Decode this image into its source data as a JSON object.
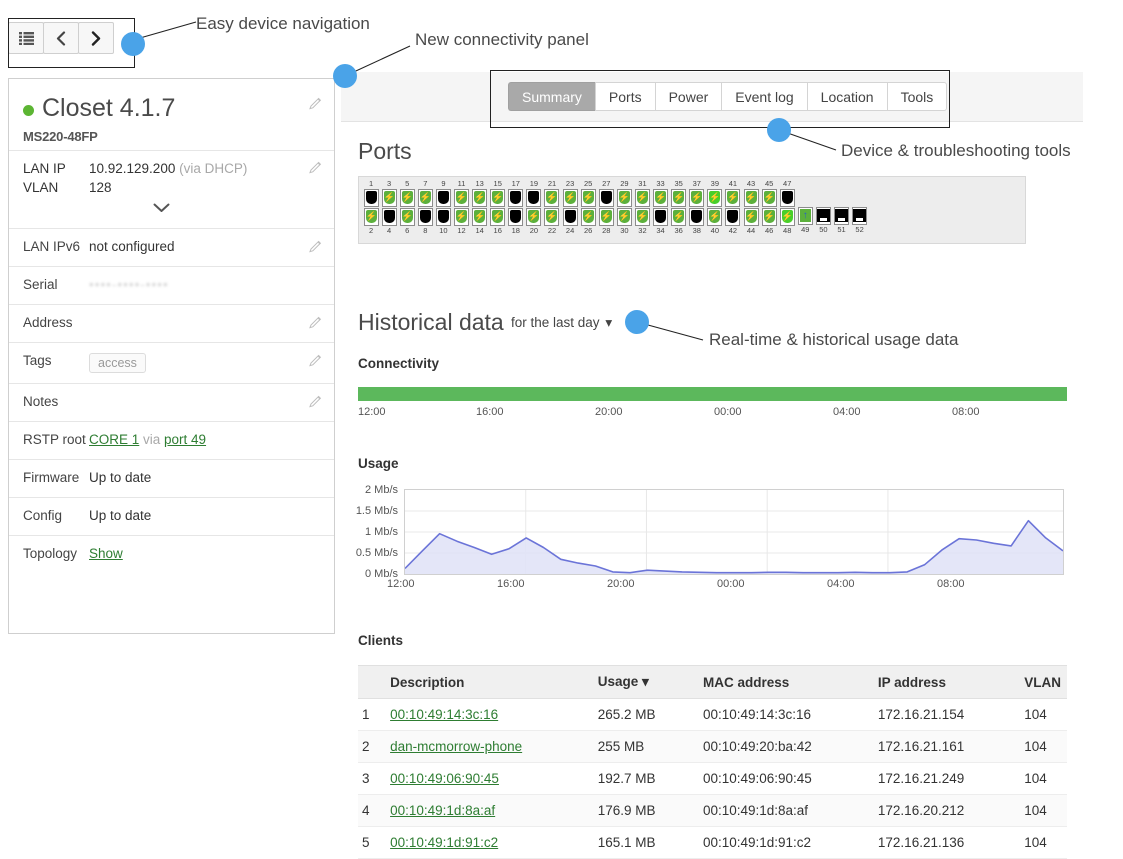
{
  "annotations": [
    {
      "id": "nav",
      "text": "Easy device navigation"
    },
    {
      "id": "conn",
      "text": "New connectivity panel"
    },
    {
      "id": "tools",
      "text": "Device & troubleshooting tools"
    },
    {
      "id": "usage",
      "text": "Real-time & historical usage data"
    }
  ],
  "nav": {
    "list_label": "list-icon",
    "prev_label": "‹",
    "next_label": "›"
  },
  "device": {
    "status_color": "#5cb533",
    "name": "Closet 4.1.7",
    "model": "MS220-48FP",
    "lan_ip_label": "LAN IP",
    "lan_ip_value": "10.92.129.200",
    "lan_ip_source": "(via DHCP)",
    "vlan_label": "VLAN",
    "vlan_value": "128",
    "rows": [
      {
        "key": "LAN IPv6",
        "value": "not configured",
        "edit": true,
        "type": "text"
      },
      {
        "key": "Serial",
        "value": "••••-••••-••••",
        "edit": false,
        "type": "blur"
      },
      {
        "key": "Address",
        "value": "",
        "edit": true,
        "type": "text"
      },
      {
        "key": "Tags",
        "value": "access",
        "edit": true,
        "type": "tag"
      },
      {
        "key": "Notes",
        "value": "",
        "edit": true,
        "type": "text"
      },
      {
        "key": "RSTP root",
        "value": "CORE 1 via port 49",
        "edit": false,
        "type": "rstp",
        "link1": "CORE 1",
        "mid": " via ",
        "link2": "port 49"
      },
      {
        "key": "Firmware",
        "value": "Up to date",
        "edit": false,
        "type": "text"
      },
      {
        "key": "Config",
        "value": "Up to date",
        "edit": false,
        "type": "text"
      },
      {
        "key": "Topology",
        "value": "Show",
        "edit": false,
        "type": "link"
      }
    ]
  },
  "tabs": [
    {
      "label": "Summary",
      "active": true
    },
    {
      "label": "Ports",
      "active": false
    },
    {
      "label": "Power",
      "active": false
    },
    {
      "label": "Event log",
      "active": false
    },
    {
      "label": "Location",
      "active": false
    },
    {
      "label": "Tools",
      "active": false
    }
  ],
  "ports": {
    "title": "Ports",
    "columns": [
      {
        "top": {
          "num": "1",
          "state": "off"
        },
        "bottom": {
          "num": "2",
          "state": "on"
        }
      },
      {
        "top": {
          "num": "3",
          "state": "on"
        },
        "bottom": {
          "num": "4",
          "state": "off"
        }
      },
      {
        "top": {
          "num": "5",
          "state": "on"
        },
        "bottom": {
          "num": "6",
          "state": "on"
        }
      },
      {
        "top": {
          "num": "7",
          "state": "on"
        },
        "bottom": {
          "num": "8",
          "state": "off"
        }
      },
      {
        "top": {
          "num": "9",
          "state": "off"
        },
        "bottom": {
          "num": "10",
          "state": "off"
        }
      },
      {
        "top": {
          "num": "11",
          "state": "on"
        },
        "bottom": {
          "num": "12",
          "state": "on"
        }
      },
      {
        "top": {
          "num": "13",
          "state": "on"
        },
        "bottom": {
          "num": "14",
          "state": "on"
        }
      },
      {
        "top": {
          "num": "15",
          "state": "on"
        },
        "bottom": {
          "num": "16",
          "state": "on"
        }
      },
      {
        "top": {
          "num": "17",
          "state": "off"
        },
        "bottom": {
          "num": "18",
          "state": "off"
        }
      },
      {
        "top": {
          "num": "19",
          "state": "off"
        },
        "bottom": {
          "num": "20",
          "state": "on"
        }
      },
      {
        "top": {
          "num": "21",
          "state": "on"
        },
        "bottom": {
          "num": "22",
          "state": "on"
        }
      },
      {
        "top": {
          "num": "23",
          "state": "on"
        },
        "bottom": {
          "num": "24",
          "state": "off"
        }
      },
      {
        "top": {
          "num": "25",
          "state": "on"
        },
        "bottom": {
          "num": "26",
          "state": "on"
        }
      },
      {
        "top": {
          "num": "27",
          "state": "off"
        },
        "bottom": {
          "num": "28",
          "state": "on"
        }
      },
      {
        "top": {
          "num": "29",
          "state": "on"
        },
        "bottom": {
          "num": "30",
          "state": "on"
        }
      },
      {
        "top": {
          "num": "31",
          "state": "on"
        },
        "bottom": {
          "num": "32",
          "state": "on"
        }
      },
      {
        "top": {
          "num": "33",
          "state": "on"
        },
        "bottom": {
          "num": "34",
          "state": "off"
        }
      },
      {
        "top": {
          "num": "35",
          "state": "on"
        },
        "bottom": {
          "num": "36",
          "state": "on"
        }
      },
      {
        "top": {
          "num": "37",
          "state": "on"
        },
        "bottom": {
          "num": "38",
          "state": "off"
        }
      },
      {
        "top": {
          "num": "39",
          "state": "on-bright"
        },
        "bottom": {
          "num": "40",
          "state": "on"
        }
      },
      {
        "top": {
          "num": "41",
          "state": "on"
        },
        "bottom": {
          "num": "42",
          "state": "off"
        }
      },
      {
        "top": {
          "num": "43",
          "state": "on"
        },
        "bottom": {
          "num": "44",
          "state": "on"
        }
      },
      {
        "top": {
          "num": "45",
          "state": "on"
        },
        "bottom": {
          "num": "46",
          "state": "on"
        }
      },
      {
        "top": {
          "num": "47",
          "state": "off"
        },
        "bottom": {
          "num": "48",
          "state": "on-bright"
        }
      },
      {
        "top": {
          "num": "",
          "state": "blank"
        },
        "bottom": {
          "num": "49",
          "state": "uplink"
        }
      },
      {
        "top": {
          "num": "",
          "state": "blank"
        },
        "bottom": {
          "num": "50",
          "state": "sfp"
        }
      },
      {
        "top": {
          "num": "",
          "state": "blank"
        },
        "bottom": {
          "num": "51",
          "state": "sfp"
        }
      },
      {
        "top": {
          "num": "",
          "state": "blank"
        },
        "bottom": {
          "num": "52",
          "state": "sfp"
        }
      }
    ]
  },
  "historical": {
    "title": "Historical data",
    "range_label": "for the last day",
    "connectivity_label": "Connectivity",
    "usage_label": "Usage"
  },
  "chart_data": [
    {
      "type": "bar",
      "title": "Connectivity",
      "categories": [
        "12:00",
        "16:00",
        "20:00",
        "00:00",
        "04:00",
        "08:00"
      ],
      "values": [
        100,
        100,
        100,
        100,
        100,
        100
      ],
      "color": "#5cb85c",
      "ylabel": "",
      "xlabel": "",
      "grid": false,
      "legend": "none"
    },
    {
      "type": "area",
      "title": "Usage",
      "xlabel": "",
      "ylabel": "Mb/s",
      "ylim": [
        0,
        2
      ],
      "yticks": [
        "0 Mb/s",
        "0.5 Mb/s",
        "1 Mb/s",
        "1.5 Mb/s",
        "2 Mb/s"
      ],
      "xticks": [
        "12:00",
        "16:00",
        "20:00",
        "00:00",
        "04:00",
        "08:00"
      ],
      "grid": true,
      "legend": "none",
      "line_color": "#6b74d8",
      "fill_color": "#dfe2f7",
      "x": [
        0,
        1,
        2,
        3,
        4,
        5,
        6,
        7,
        8,
        9,
        10,
        11,
        12,
        13,
        14,
        15,
        16,
        17,
        18,
        19,
        20,
        21,
        22,
        23,
        24,
        25,
        26,
        27,
        28,
        29,
        30,
        31,
        32,
        33,
        34,
        35,
        36,
        37,
        38
      ],
      "values": [
        0.13,
        0.55,
        0.96,
        0.78,
        0.63,
        0.47,
        0.6,
        0.86,
        0.63,
        0.35,
        0.26,
        0.19,
        0.05,
        0.03,
        0.09,
        0.07,
        0.05,
        0.04,
        0.03,
        0.03,
        0.03,
        0.04,
        0.04,
        0.03,
        0.03,
        0.03,
        0.04,
        0.03,
        0.03,
        0.05,
        0.22,
        0.57,
        0.84,
        0.81,
        0.73,
        0.67,
        1.27,
        0.86,
        0.55
      ]
    }
  ],
  "clients": {
    "title": "Clients",
    "headers": [
      "",
      "Description",
      "Usage ▾",
      "MAC address",
      "IP address",
      "VLAN"
    ],
    "rows": [
      {
        "idx": "1",
        "desc": "00:10:49:14:3c:16",
        "usage": "265.2 MB",
        "mac": "00:10:49:14:3c:16",
        "ip": "172.16.21.154",
        "vlan": "104"
      },
      {
        "idx": "2",
        "desc": "dan-mcmorrow-phone",
        "usage": "255 MB",
        "mac": "00:10:49:20:ba:42",
        "ip": "172.16.21.161",
        "vlan": "104"
      },
      {
        "idx": "3",
        "desc": "00:10:49:06:90:45",
        "usage": "192.7 MB",
        "mac": "00:10:49:06:90:45",
        "ip": "172.16.21.249",
        "vlan": "104"
      },
      {
        "idx": "4",
        "desc": "00:10:49:1d:8a:af",
        "usage": "176.9 MB",
        "mac": "00:10:49:1d:8a:af",
        "ip": "172.16.20.212",
        "vlan": "104"
      },
      {
        "idx": "5",
        "desc": "00:10:49:1d:91:c2",
        "usage": "165.1 MB",
        "mac": "00:10:49:1d:91:c2",
        "ip": "172.16.21.136",
        "vlan": "104"
      }
    ]
  }
}
